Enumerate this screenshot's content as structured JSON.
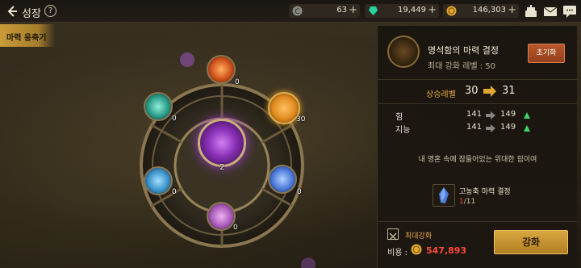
{
  "header": {
    "title": "성장",
    "help_symbol": "?"
  },
  "currencies": [
    {
      "icon": "coin-c-icon",
      "value": "63",
      "plus": "+"
    },
    {
      "icon": "green-gem-icon",
      "value": "19,449",
      "plus": "+"
    },
    {
      "icon": "gold-coin-icon",
      "value": "146,303",
      "plus": "+"
    }
  ],
  "top_icons": [
    "cake-icon",
    "mail-icon",
    "chat-icon"
  ],
  "tab": {
    "label": "마력 응축기"
  },
  "wheel": {
    "center_level": "2",
    "nodes": [
      {
        "name": "top",
        "level": "0",
        "color": "#e0621e"
      },
      {
        "name": "upper-right",
        "level": "30",
        "color": "#e08a1e"
      },
      {
        "name": "lower-right",
        "level": "0",
        "color": "#5a8ee8"
      },
      {
        "name": "bottom",
        "level": "0",
        "color": "#b56ac8"
      },
      {
        "name": "lower-left",
        "level": "0",
        "color": "#4aa0d8"
      },
      {
        "name": "upper-left",
        "level": "0",
        "color": "#2ab8a0"
      }
    ]
  },
  "panel": {
    "item_name": "명석함의 마력 결정",
    "item_max": "최대 강화 레벨 : 50",
    "reset_label": "초기화",
    "level_label": "상승레벨",
    "level_from": "30",
    "level_to": "31",
    "stats": [
      {
        "name": "힘",
        "from": "141",
        "to": "149"
      },
      {
        "name": "지능",
        "from": "141",
        "to": "149"
      }
    ],
    "description": "내 영혼 속에 잠들어있는 위대한 힘이여",
    "material": {
      "name": "고농축 마력 결정",
      "have": "1",
      "need": "/11"
    },
    "max_label": "최대강화",
    "cost_label": "비용 :",
    "cost_value": "547,893",
    "enhance_label": "강화"
  },
  "colors": {
    "accent_gold": "#d9a640",
    "insufficient_red": "#ff4a3a",
    "level_orange": "#e3a94a",
    "up_green": "#3fd26a"
  }
}
